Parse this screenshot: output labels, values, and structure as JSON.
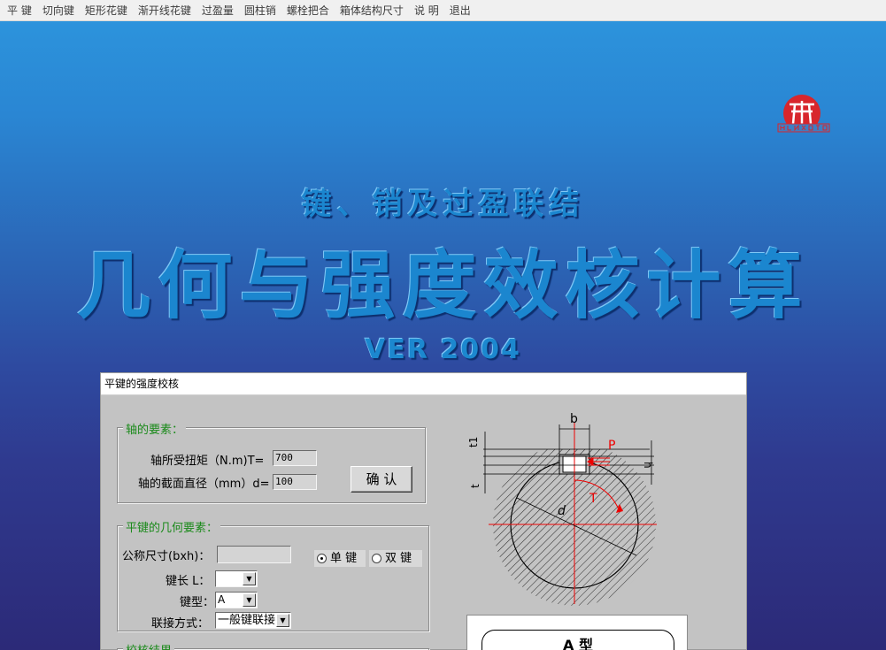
{
  "menu": [
    "平 键",
    "切向键",
    "矩形花键",
    "渐开线花键",
    "过盈量",
    "圆柱销",
    "螺栓把合",
    "箱体结构尺寸",
    "说 明",
    "退出"
  ],
  "splash": {
    "subtitle": "键、销及过盈联结",
    "title": "几何与强度效核计算",
    "version": "VER 2004"
  },
  "dialog": {
    "title": "平键的强度校核",
    "shaft_group": {
      "label": "轴的要素：",
      "torque_label": "轴所受扭矩（N.m)T=",
      "torque_value": "700",
      "diameter_label": "轴的截面直径（mm）d=",
      "diameter_value": "100",
      "confirm_label": "确 认"
    },
    "key_group": {
      "label": "平键的几何要素：",
      "nominal_label": "公称尺寸(bxh)：",
      "nominal_value": "",
      "single_key": "单 键",
      "double_key": "双 键",
      "length_label": "键长 L：",
      "length_value": "",
      "type_label": "键型：",
      "type_value": "A",
      "connection_label": "联接方式：",
      "connection_value": "一般键联接"
    },
    "result_group_label": "校核结果",
    "diagram": {
      "b": "b",
      "t1": "t1",
      "t": "t",
      "h": "h",
      "P": "P",
      "T": "T",
      "d": "d",
      "type_a": "A 型"
    }
  },
  "colors": {
    "title_blue": "#1b86cf",
    "group_label_green": "#1a8a1a",
    "dialog_gray": "#c3c3c3",
    "logo_red": "#d8262c"
  }
}
